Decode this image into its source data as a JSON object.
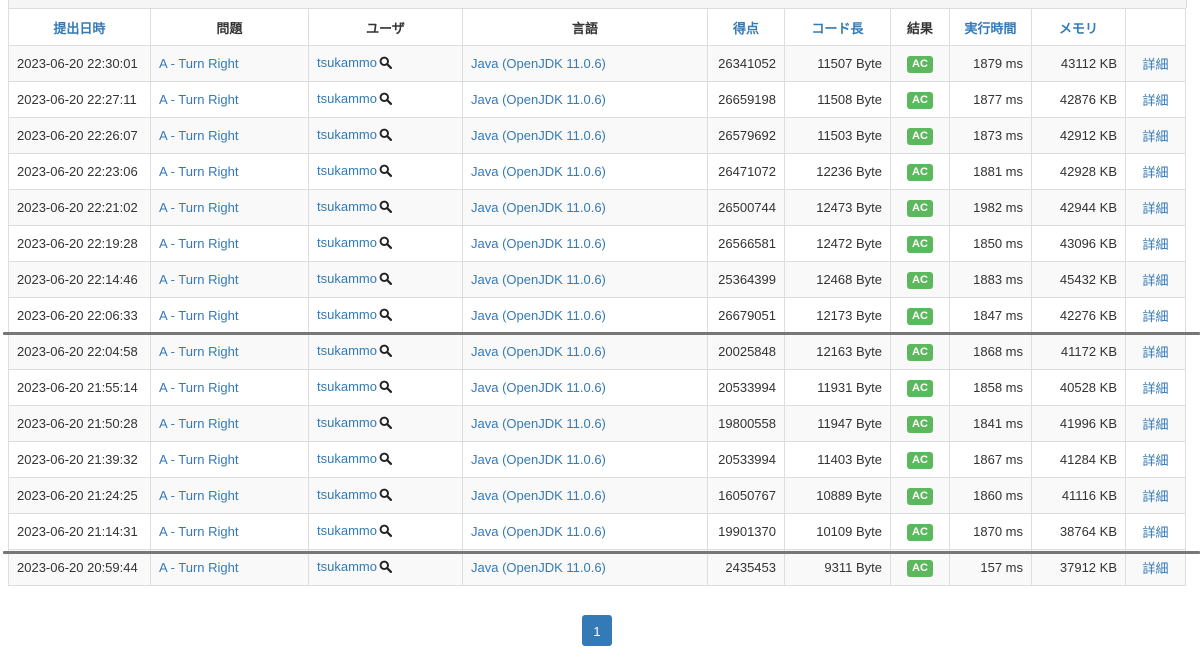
{
  "columns": [
    {
      "key": "submit_time",
      "label": "提出日時",
      "sortable": true
    },
    {
      "key": "problem",
      "label": "問題",
      "sortable": false
    },
    {
      "key": "user",
      "label": "ユーザ",
      "sortable": false
    },
    {
      "key": "language",
      "label": "言語",
      "sortable": false
    },
    {
      "key": "score",
      "label": "得点",
      "sortable": true
    },
    {
      "key": "code_length",
      "label": "コード長",
      "sortable": true
    },
    {
      "key": "result",
      "label": "結果",
      "sortable": false
    },
    {
      "key": "exec_time",
      "label": "実行時間",
      "sortable": true
    },
    {
      "key": "memory",
      "label": "メモリ",
      "sortable": true
    },
    {
      "key": "detail",
      "label": "",
      "sortable": false
    }
  ],
  "rows": [
    {
      "submit_time": "2023-06-20 22:30:01",
      "problem": "A - Turn Right",
      "user": "tsukammo",
      "language": "Java (OpenJDK 11.0.6)",
      "score": "26341052",
      "code_length": "11507 Byte",
      "result": "AC",
      "exec_time": "1879 ms",
      "memory": "43112 KB",
      "detail": "詳細"
    },
    {
      "submit_time": "2023-06-20 22:27:11",
      "problem": "A - Turn Right",
      "user": "tsukammo",
      "language": "Java (OpenJDK 11.0.6)",
      "score": "26659198",
      "code_length": "11508 Byte",
      "result": "AC",
      "exec_time": "1877 ms",
      "memory": "42876 KB",
      "detail": "詳細"
    },
    {
      "submit_time": "2023-06-20 22:26:07",
      "problem": "A - Turn Right",
      "user": "tsukammo",
      "language": "Java (OpenJDK 11.0.6)",
      "score": "26579692",
      "code_length": "11503 Byte",
      "result": "AC",
      "exec_time": "1873 ms",
      "memory": "42912 KB",
      "detail": "詳細"
    },
    {
      "submit_time": "2023-06-20 22:23:06",
      "problem": "A - Turn Right",
      "user": "tsukammo",
      "language": "Java (OpenJDK 11.0.6)",
      "score": "26471072",
      "code_length": "12236 Byte",
      "result": "AC",
      "exec_time": "1881 ms",
      "memory": "42928 KB",
      "detail": "詳細"
    },
    {
      "submit_time": "2023-06-20 22:21:02",
      "problem": "A - Turn Right",
      "user": "tsukammo",
      "language": "Java (OpenJDK 11.0.6)",
      "score": "26500744",
      "code_length": "12473 Byte",
      "result": "AC",
      "exec_time": "1982 ms",
      "memory": "42944 KB",
      "detail": "詳細"
    },
    {
      "submit_time": "2023-06-20 22:19:28",
      "problem": "A - Turn Right",
      "user": "tsukammo",
      "language": "Java (OpenJDK 11.0.6)",
      "score": "26566581",
      "code_length": "12472 Byte",
      "result": "AC",
      "exec_time": "1850 ms",
      "memory": "43096 KB",
      "detail": "詳細"
    },
    {
      "submit_time": "2023-06-20 22:14:46",
      "problem": "A - Turn Right",
      "user": "tsukammo",
      "language": "Java (OpenJDK 11.0.6)",
      "score": "25364399",
      "code_length": "12468 Byte",
      "result": "AC",
      "exec_time": "1883 ms",
      "memory": "45432 KB",
      "detail": "詳細"
    },
    {
      "submit_time": "2023-06-20 22:06:33",
      "problem": "A - Turn Right",
      "user": "tsukammo",
      "language": "Java (OpenJDK 11.0.6)",
      "score": "26679051",
      "code_length": "12173 Byte",
      "result": "AC",
      "exec_time": "1847 ms",
      "memory": "42276 KB",
      "detail": "詳細"
    },
    {
      "submit_time": "2023-06-20 22:04:58",
      "problem": "A - Turn Right",
      "user": "tsukammo",
      "language": "Java (OpenJDK 11.0.6)",
      "score": "20025848",
      "code_length": "12163 Byte",
      "result": "AC",
      "exec_time": "1868 ms",
      "memory": "41172 KB",
      "detail": "詳細"
    },
    {
      "submit_time": "2023-06-20 21:55:14",
      "problem": "A - Turn Right",
      "user": "tsukammo",
      "language": "Java (OpenJDK 11.0.6)",
      "score": "20533994",
      "code_length": "11931 Byte",
      "result": "AC",
      "exec_time": "1858 ms",
      "memory": "40528 KB",
      "detail": "詳細"
    },
    {
      "submit_time": "2023-06-20 21:50:28",
      "problem": "A - Turn Right",
      "user": "tsukammo",
      "language": "Java (OpenJDK 11.0.6)",
      "score": "19800558",
      "code_length": "11947 Byte",
      "result": "AC",
      "exec_time": "1841 ms",
      "memory": "41996 KB",
      "detail": "詳細"
    },
    {
      "submit_time": "2023-06-20 21:39:32",
      "problem": "A - Turn Right",
      "user": "tsukammo",
      "language": "Java (OpenJDK 11.0.6)",
      "score": "20533994",
      "code_length": "11403 Byte",
      "result": "AC",
      "exec_time": "1867 ms",
      "memory": "41284 KB",
      "detail": "詳細"
    },
    {
      "submit_time": "2023-06-20 21:24:25",
      "problem": "A - Turn Right",
      "user": "tsukammo",
      "language": "Java (OpenJDK 11.0.6)",
      "score": "16050767",
      "code_length": "10889 Byte",
      "result": "AC",
      "exec_time": "1860 ms",
      "memory": "41116 KB",
      "detail": "詳細"
    },
    {
      "submit_time": "2023-06-20 21:14:31",
      "problem": "A - Turn Right",
      "user": "tsukammo",
      "language": "Java (OpenJDK 11.0.6)",
      "score": "19901370",
      "code_length": "10109 Byte",
      "result": "AC",
      "exec_time": "1870 ms",
      "memory": "38764 KB",
      "detail": "詳細"
    },
    {
      "submit_time": "2023-06-20 20:59:44",
      "problem": "A - Turn Right",
      "user": "tsukammo",
      "language": "Java (OpenJDK 11.0.6)",
      "score": "2435453",
      "code_length": "9311 Byte",
      "result": "AC",
      "exec_time": "157 ms",
      "memory": "37912 KB",
      "detail": "詳細"
    }
  ],
  "pagination": {
    "current_page": "1"
  },
  "icons": {
    "user_search": "magnifier-icon"
  },
  "colors": {
    "link": "#337ab7",
    "ac_badge": "#5cb85c",
    "divider": "#777777",
    "page_active": "#337ab7"
  }
}
